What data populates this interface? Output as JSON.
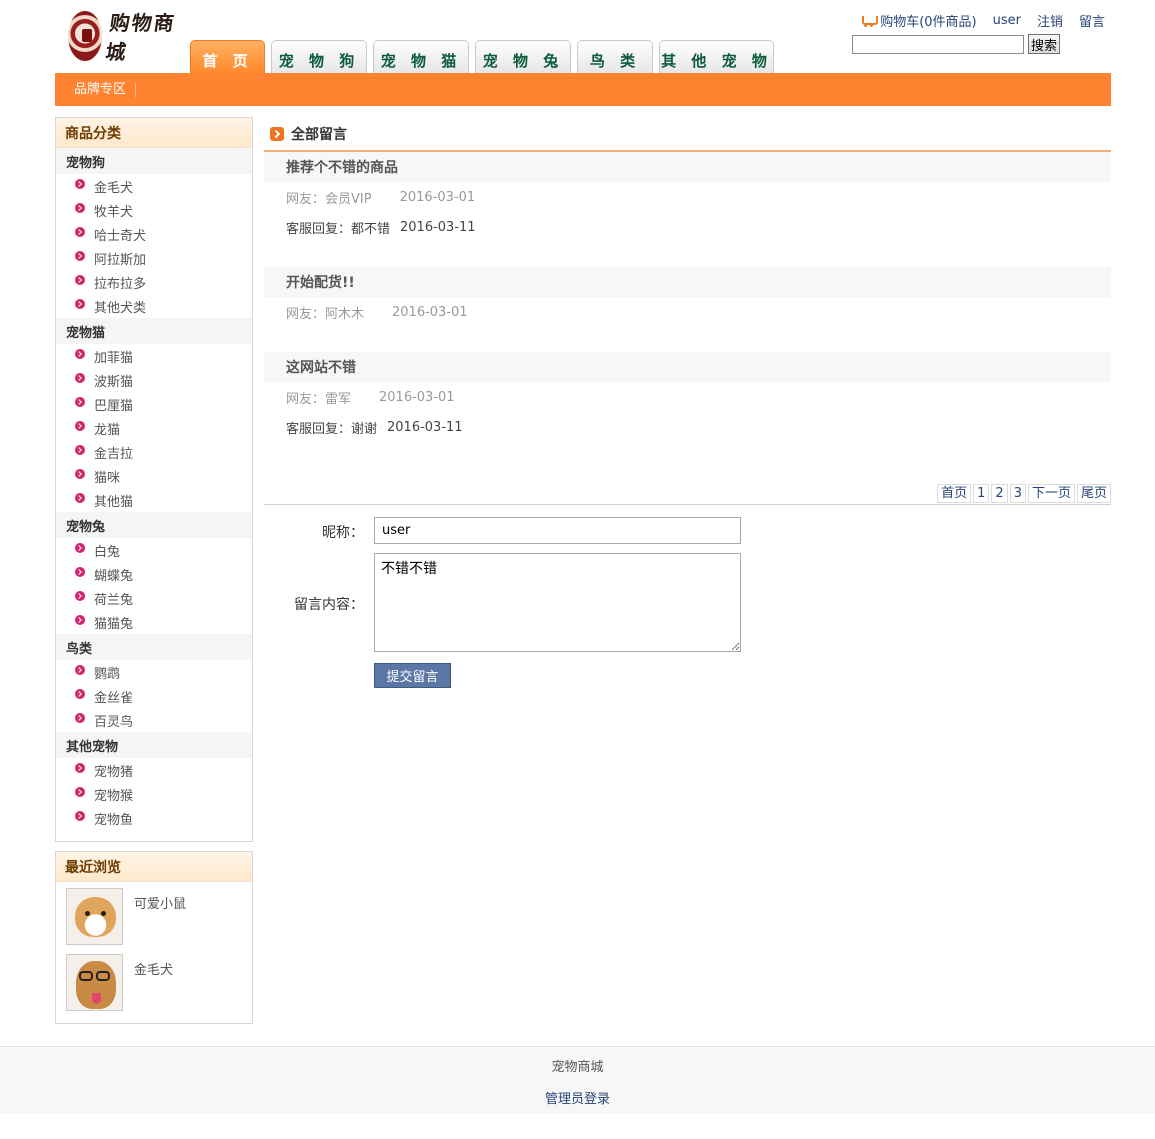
{
  "header": {
    "logo_text": "购物商城",
    "nav_tabs": [
      "首 页",
      "宠 物 狗",
      "宠 物 猫",
      "宠 物 兔",
      "鸟 类",
      "其 他 宠 物"
    ],
    "cart_label": "购物车(0件商品)",
    "username": "user",
    "logout_label": "注销",
    "message_label": "留言",
    "search_button": "搜索",
    "search_value": "",
    "brand_link": "品牌专区"
  },
  "sidebar": {
    "categories_title": "商品分类",
    "groups": [
      {
        "name": "宠物狗",
        "items": [
          "金毛犬",
          "牧羊犬",
          "哈士奇犬",
          "阿拉斯加",
          "拉布拉多",
          "其他犬类"
        ]
      },
      {
        "name": "宠物猫",
        "items": [
          "加菲猫",
          "波斯猫",
          "巴厘猫",
          "龙猫",
          "金吉拉",
          "猫咪",
          "其他猫"
        ]
      },
      {
        "name": "宠物兔",
        "items": [
          "白兔",
          "蝴蝶兔",
          "荷兰兔",
          "猫猫兔"
        ]
      },
      {
        "name": "鸟类",
        "items": [
          "鹦鹉",
          "金丝雀",
          "百灵鸟"
        ]
      },
      {
        "name": "其他宠物",
        "items": [
          "宠物猪",
          "宠物猴",
          "宠物鱼"
        ]
      }
    ],
    "recent_title": "最近浏览",
    "recent_items": [
      "可爱小鼠",
      "金毛犬"
    ]
  },
  "main": {
    "title": "全部留言",
    "messages": [
      {
        "title": "推荐个不错的商品",
        "author": "网友：会员VIP",
        "date": "2016-03-01",
        "reply": "客服回复：都不错",
        "reply_date": "2016-03-11"
      },
      {
        "title": "开始配货!!",
        "author": "网友：阿木木",
        "date": "2016-03-01",
        "reply": "",
        "reply_date": ""
      },
      {
        "title": "这网站不错",
        "author": "网友：雷军",
        "date": "2016-03-01",
        "reply": "客服回复：谢谢",
        "reply_date": "2016-03-11"
      }
    ],
    "pager": [
      "首页",
      "1",
      "2",
      "3",
      "下一页",
      "尾页"
    ],
    "form": {
      "nickname_label": "昵称：",
      "nickname_value": "user",
      "content_label": "留言内容：",
      "content_value": "不错不错",
      "submit_label": "提交留言"
    }
  },
  "footer": {
    "site_name": "宠物商城",
    "admin_login": "管理员登录"
  }
}
